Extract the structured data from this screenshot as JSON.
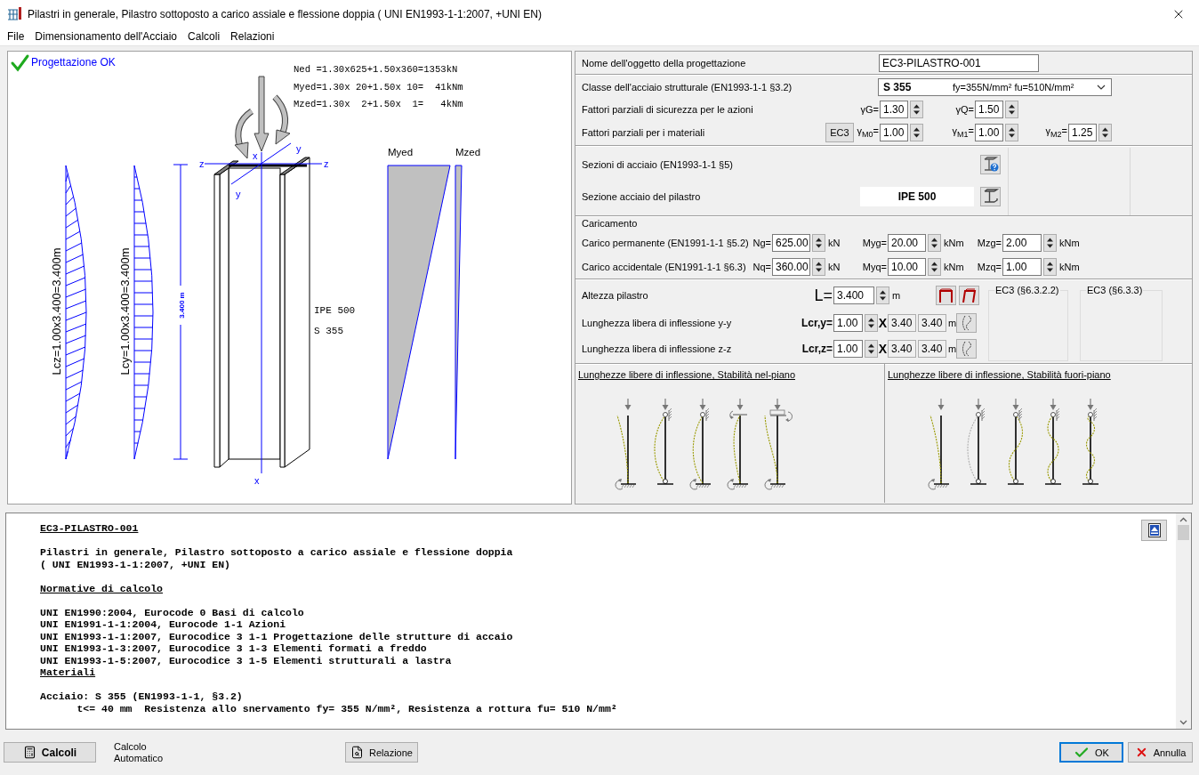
{
  "window": {
    "title": "Pilastri in generale, Pilastro sottoposto a carico assiale e flessione doppia ( UNI EN1993-1-1:2007, +UNI EN)"
  },
  "menu": [
    {
      "label": "File"
    },
    {
      "label": "Dimensionamento dell'Acciaio"
    },
    {
      "label": "Calcoli"
    },
    {
      "label": "Relazioni"
    }
  ],
  "drawing": {
    "status": "Progettazione OK",
    "formulas": [
      "Ned =1.30x625+1.50x360=1353kN",
      "Myed=1.30x 20+1.50x 10=  41kNm",
      "Mzed=1.30x  2+1.50x  1=   4kNm"
    ],
    "axis_labels": [
      "z",
      "z",
      "y",
      "y",
      "x",
      "x"
    ],
    "buckling_labels": [
      "Lcz=1.00x3.400=3.400m",
      "Lcy=1.00x3.400=3.400m"
    ],
    "height_label": "3.400 m",
    "section": "IPE 500",
    "steel": "S 355",
    "moment_labels": [
      "Myed",
      "Mzed"
    ]
  },
  "design": {
    "label": "Nome dell'oggetto della progettazione",
    "value": "EC3-PILASTRO-001"
  },
  "steel": {
    "label": "Classe dell'acciaio strutturale (EN1993-1-1 §3.2)",
    "grade": "S 355",
    "properties": "fy=355N/mm² fu=510N/mm²"
  },
  "action_factors": {
    "label": "Fattori parziali di sicurezza per le azioni",
    "fields": [
      {
        "label": "γG=",
        "value": "1.30"
      },
      {
        "label": "γQ=",
        "value": "1.50"
      }
    ]
  },
  "material_factors": {
    "label": "Fattori parziali per i materiali",
    "button": "EC3",
    "fields": [
      {
        "label": "γ$_{M0}$=",
        "value": "1.00"
      },
      {
        "label": "γ$_{M1}$=",
        "value": "1.00"
      },
      {
        "label": "γ$_{M2}$=",
        "value": "1.25"
      }
    ]
  },
  "sections": {
    "label": "Sezioni di acciaio (EN1993-1-1 §5)",
    "column_label": "Sezione acciaio del pilastro",
    "column_section": "IPE 500"
  },
  "loads": {
    "title": "Caricamento",
    "rows": [
      {
        "label": "Carico permanente (EN1991-1-1 §5.2)",
        "fields": [
          {
            "symbol": "Ng=",
            "value": "625.00",
            "unit": "kN"
          },
          {
            "symbol": "Myg=",
            "value": "20.00",
            "unit": "kNm"
          },
          {
            "symbol": "Mzg=",
            "value": "2.00",
            "unit": "kNm"
          }
        ]
      },
      {
        "label": "Carico accidentale (EN1991-1-1 §6.3)",
        "fields": [
          {
            "symbol": "Nq=",
            "value": "360.00",
            "unit": "kN"
          },
          {
            "symbol": "Myq=",
            "value": "10.00",
            "unit": "kNm"
          },
          {
            "symbol": "Mzq=",
            "value": "1.00",
            "unit": "kNm"
          }
        ]
      }
    ]
  },
  "height": {
    "label": "Altezza pilastro",
    "symbol": "L=",
    "value": "3.400",
    "unit": "m"
  },
  "buckling_lengths": [
    {
      "label": "Lunghezza libera di inflessione y-y",
      "symbol": "Lcr,y=",
      "factor": "1.00",
      "times": "X",
      "length": "3.40",
      "result": "3.40",
      "unit": "m"
    },
    {
      "label": "Lunghezza libera di inflessione z-z",
      "symbol": "Lcr,z=",
      "factor": "1.00",
      "times": "X",
      "length": "3.40",
      "result": "3.40",
      "unit": "m"
    }
  ],
  "check_groups": [
    {
      "title": "EC3 (§6.3.2.2)"
    },
    {
      "title": "EC3 (§6.3.3)"
    }
  ],
  "buckling_panels": [
    {
      "title": "Lunghezze libere di inflessione, Stabilità nel-piano"
    },
    {
      "title": "Lunghezze libere di inflessione, Stabilità fuori-piano"
    }
  ],
  "report": {
    "lines": [
      {
        "kind": "heading",
        "text": "EC3-PILASTRO-001"
      },
      {
        "kind": "blank"
      },
      {
        "kind": "text",
        "text": "Pilastri in generale, Pilastro sottoposto a carico assiale e flessione doppia"
      },
      {
        "kind": "text",
        "text": "( UNI EN1993-1-1:2007, +UNI EN)"
      },
      {
        "kind": "blank"
      },
      {
        "kind": "heading",
        "text": "Normative di calcolo"
      },
      {
        "kind": "blank"
      },
      {
        "kind": "text",
        "text": "UNI EN1990:2004, Eurocode 0 Basi di calcolo"
      },
      {
        "kind": "text",
        "text": "UNI EN1991-1-1:2004, Eurocode 1-1 Azioni"
      },
      {
        "kind": "text",
        "text": "UNI EN1993-1-1:2007, Eurocodice 3 1-1 Progettazione delle strutture di accaio"
      },
      {
        "kind": "text",
        "text": "UNI EN1993-1-3:2007, Eurocodice 3 1-3 Elementi formati a freddo"
      },
      {
        "kind": "text",
        "text": "UNI EN1993-1-5:2007, Eurocodice 3 1-5 Elementi strutturali a lastra"
      },
      {
        "kind": "heading",
        "text": "Materiali"
      },
      {
        "kind": "blank"
      },
      {
        "kind": "text",
        "text": "Acciaio: S 355 (EN1993-1-1, §3.2)"
      },
      {
        "kind": "indent",
        "text": "t<= 40 mm  Resistenza allo snervamento fy= 355 N/mm², Resistenza a rottura fu= 510 N/mm²"
      }
    ]
  },
  "footer": {
    "calc_button": "Calcoli",
    "auto_label": "Calcolo Automatico",
    "report_button": "Relazione",
    "ok_button": "OK",
    "cancel_button": "Annulla"
  }
}
